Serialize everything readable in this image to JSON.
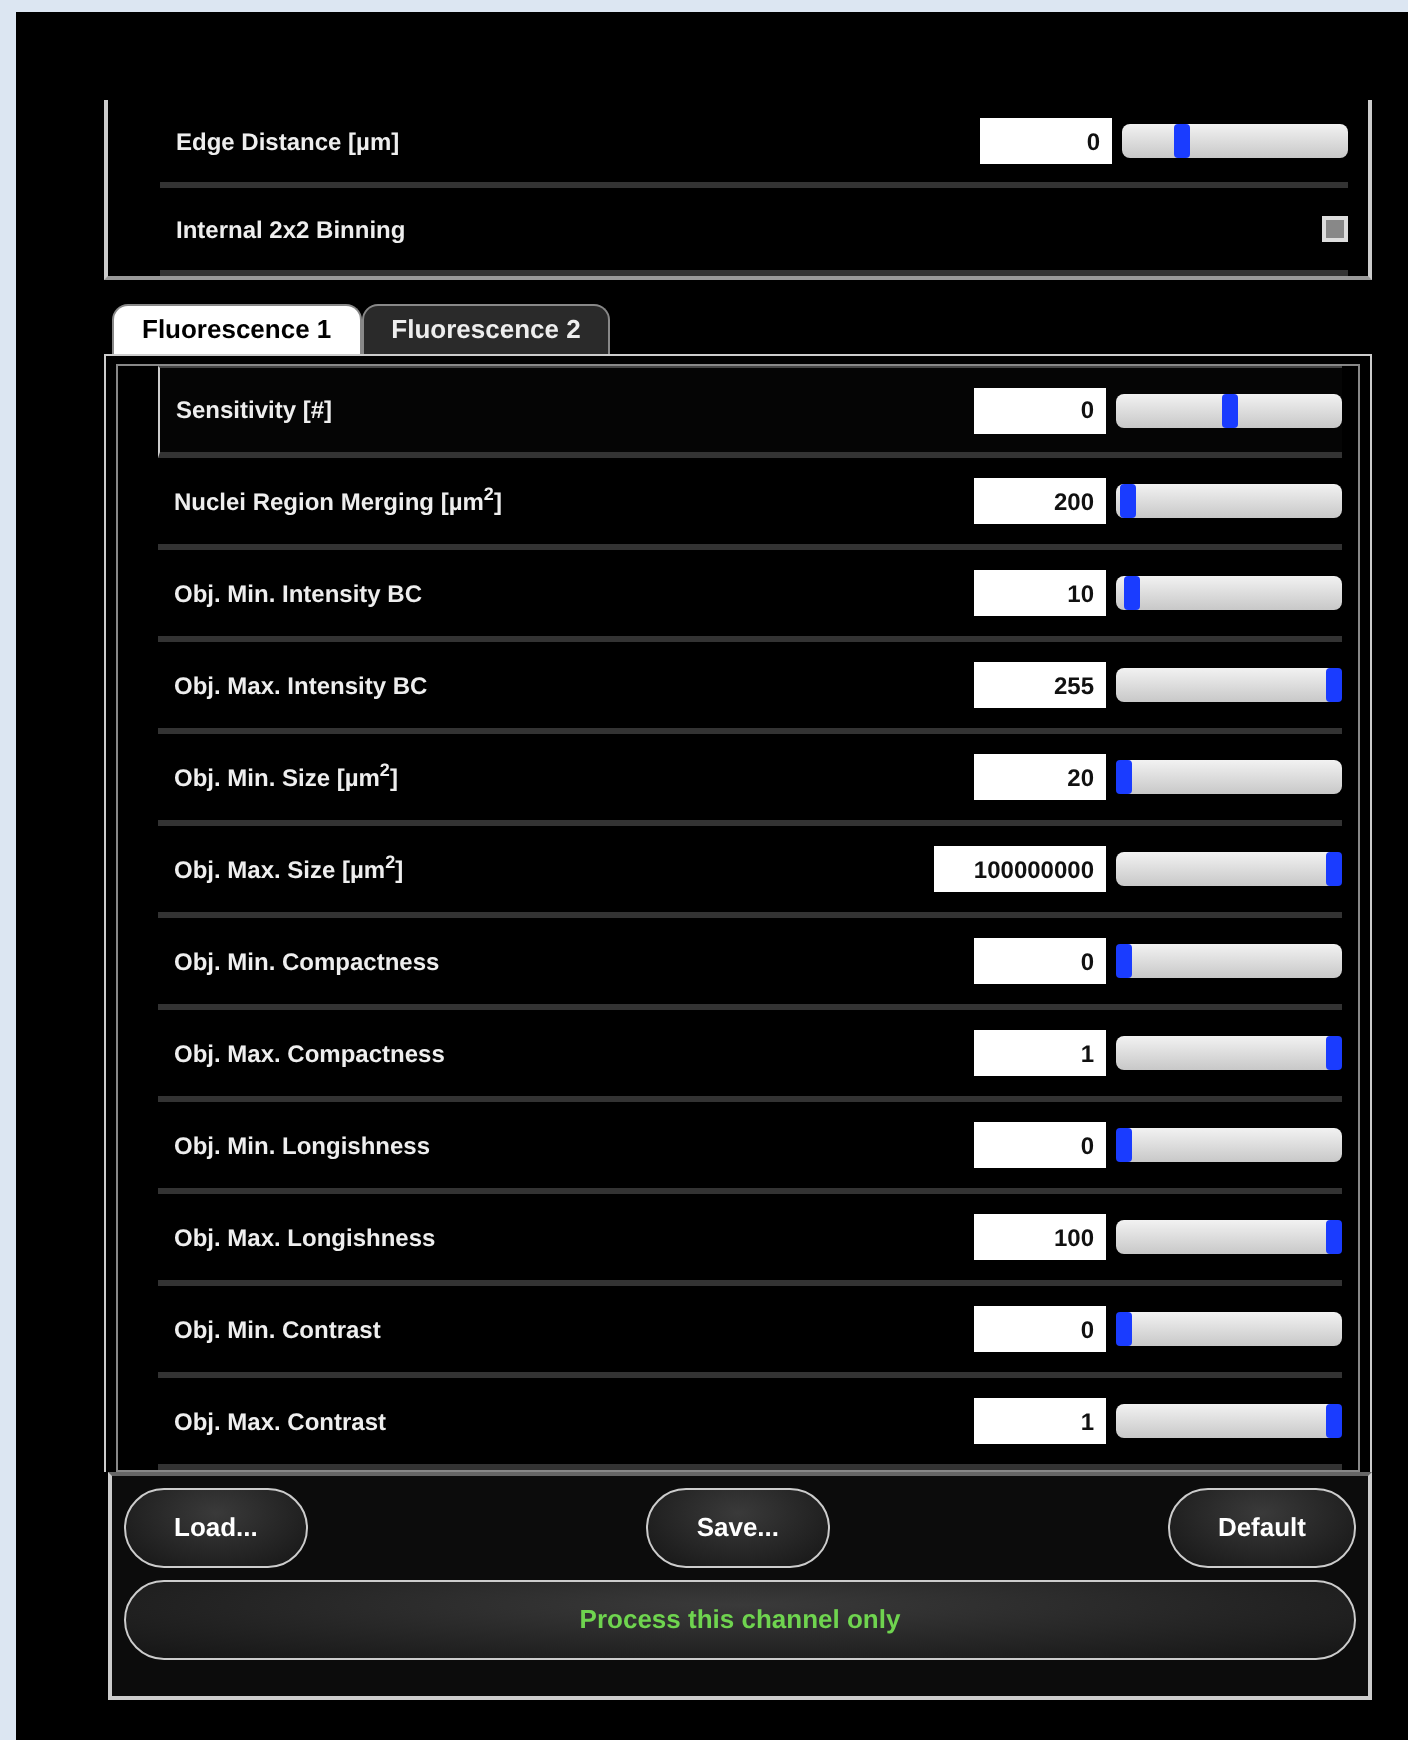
{
  "top_params": [
    {
      "kind": "slider",
      "label": "Edge Distance [µm]",
      "value": "0",
      "level": 0.25
    },
    {
      "kind": "checkbox",
      "label": "Internal 2x2 Binning",
      "checked": false
    }
  ],
  "tabs": [
    {
      "label": "Fluorescence 1",
      "selected": true
    },
    {
      "label": "Fluorescence 2",
      "selected": false
    }
  ],
  "params": [
    {
      "label": "Sensitivity [#]",
      "value": "0",
      "level": 0.5,
      "selected": true
    },
    {
      "label": "Nuclei Region Merging [µm$^{2}$]",
      "value": "200",
      "level": 0.02,
      "selected": false
    },
    {
      "label": "Obj. Min. Intensity BC",
      "value": "10",
      "level": 0.04,
      "selected": false
    },
    {
      "label": "Obj. Max. Intensity BC",
      "value": "255",
      "level": 1,
      "selected": false
    },
    {
      "label": "Obj. Min. Size [µm$^{2}$]",
      "value": "20",
      "level": 0,
      "selected": false
    },
    {
      "label": "Obj. Max. Size [µm$^{2}$]",
      "value": "100000000",
      "level": 1,
      "selected": false
    },
    {
      "label": "Obj. Min. Compactness",
      "value": "0",
      "level": 0,
      "selected": false
    },
    {
      "label": "Obj. Max. Compactness",
      "value": "1",
      "level": 1,
      "selected": false
    },
    {
      "label": "Obj. Min. Longishness",
      "value": "0",
      "level": 0,
      "selected": false
    },
    {
      "label": "Obj. Max. Longishness",
      "value": "100",
      "level": 1,
      "selected": false
    },
    {
      "label": "Obj. Min. Contrast",
      "value": "0",
      "level": 0,
      "selected": false
    },
    {
      "label": "Obj. Max. Contrast",
      "value": "1",
      "level": 1,
      "selected": false
    }
  ],
  "buttons": [
    "Load...",
    "Save...",
    "Default"
  ],
  "process_button": "Process this channel only"
}
